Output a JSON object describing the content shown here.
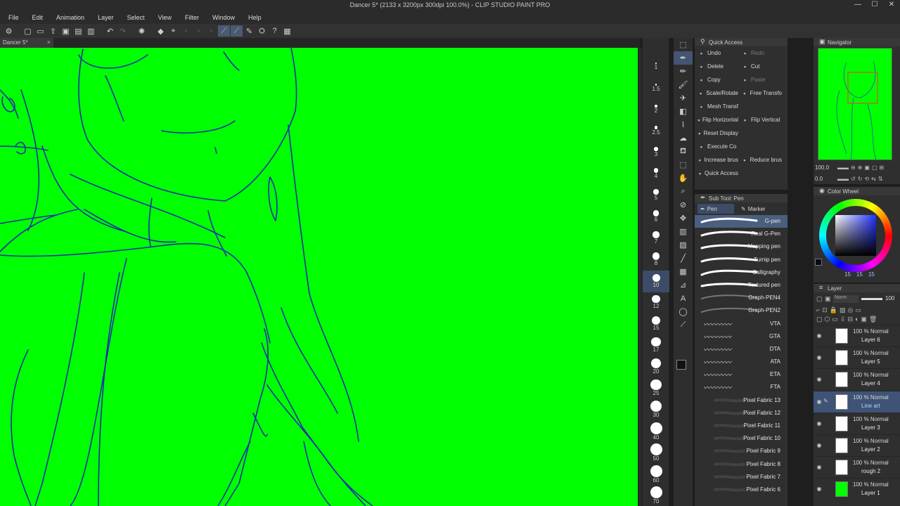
{
  "window": {
    "title": "Dancer 5* (2133 x 3200px 300dpi 100.0%) - CLIP STUDIO PAINT PRO",
    "controls": [
      "—",
      "☐",
      "✕"
    ]
  },
  "menu": [
    "File",
    "Edit",
    "Animation",
    "Layer",
    "Select",
    "View",
    "Filter",
    "Window",
    "Help"
  ],
  "document_tab": {
    "label": "Dancer 5*",
    "close": "×"
  },
  "canvas": {
    "background": "#00ff00",
    "line_color": "#1a2fa8"
  },
  "brush_sizes": [
    "1",
    "1.5",
    "2",
    "2.5",
    "3",
    "4",
    "5",
    "6",
    "7",
    "8",
    "10",
    "12",
    "15",
    "17",
    "20",
    "25",
    "30",
    "40",
    "50",
    "60",
    "70"
  ],
  "brush_sizes_selected": "10",
  "quick_access": {
    "title": "Quick Access",
    "rows": [
      [
        {
          "label": "Undo",
          "icon": "undo-icon"
        },
        {
          "label": "Redo",
          "icon": "redo-icon",
          "dim": true
        }
      ],
      [
        {
          "label": "Delete",
          "icon": "delete-icon"
        },
        {
          "label": "Cut",
          "icon": "cut-icon"
        }
      ],
      [
        {
          "label": "Copy",
          "icon": "copy-icon"
        },
        {
          "label": "Paste",
          "icon": "paste-icon",
          "dim": true
        }
      ],
      [
        {
          "label": "Scale/Rotate",
          "icon": "scale-icon"
        },
        {
          "label": "Free Transfo",
          "icon": "free-transform-icon"
        }
      ],
      [
        {
          "label": "Mesh Transf",
          "icon": "mesh-icon"
        },
        {
          "label": "",
          "icon": ""
        }
      ],
      [
        {
          "label": "Flip Horizontal",
          "icon": "flip-h-icon"
        },
        {
          "label": "Flip Vertical",
          "icon": "flip-v-icon"
        }
      ],
      [
        {
          "label": "Reset Display",
          "icon": "reset-display-icon"
        },
        {
          "label": "",
          "icon": ""
        }
      ],
      [
        {
          "label": "Execute Co",
          "icon": "execute-icon"
        },
        {
          "label": "",
          "icon": ""
        }
      ],
      [
        {
          "label": "Increase brus",
          "icon": "increase-icon"
        },
        {
          "label": "Reduce brus",
          "icon": "reduce-icon"
        }
      ],
      [
        {
          "label": "Quick Access",
          "icon": "quick-access-icon"
        },
        {
          "label": "",
          "icon": ""
        }
      ]
    ]
  },
  "sub_tool": {
    "title": "Sub Tool: Pen",
    "tabs": [
      "Pen",
      "Marker"
    ],
    "brushes": [
      "G-pen",
      "Real G-Pen",
      "Mapping pen",
      "Turnip pen",
      "Calligraphy",
      "Textured pen",
      "Graph-PEN4",
      "Graph-PEN2",
      "VTA",
      "GTA",
      "DTA",
      "ATA",
      "ETA",
      "FTA",
      "Pixel Fabric 13",
      "Pixel Fabric 12",
      "Pixel Fabric 11",
      "Pixel Fabric 10",
      "Pixel Fabric 9",
      "Pixel Fabric 8",
      "Pixel Fabric 7",
      "Pixel Fabric 6"
    ],
    "selected": "G-pen"
  },
  "navigator": {
    "title": "Navigator",
    "zoom": "100.0",
    "angle": "0.0"
  },
  "color_wheel": {
    "title": "Color Wheel",
    "values": [
      "15",
      "15",
      "15"
    ]
  },
  "layer_panel": {
    "title": "Layer",
    "blend_mode": "Norm",
    "opacity": "100",
    "layers": [
      {
        "mode": "100 % Normal",
        "name": "Layer 6",
        "selected": false
      },
      {
        "mode": "100 % Normal",
        "name": "Layer 5",
        "selected": false
      },
      {
        "mode": "100 % Normal",
        "name": "Layer 4",
        "selected": false
      },
      {
        "mode": "100 % Normal",
        "name": "Line art",
        "selected": true
      },
      {
        "mode": "100 % Normal",
        "name": "Layer 3",
        "selected": false
      },
      {
        "mode": "100 % Normal",
        "name": "Layer 2",
        "selected": false
      },
      {
        "mode": "100 % Normal",
        "name": "rough 2",
        "selected": false
      },
      {
        "mode": "100 % Normal",
        "name": "Layer 1",
        "selected": false
      }
    ]
  }
}
